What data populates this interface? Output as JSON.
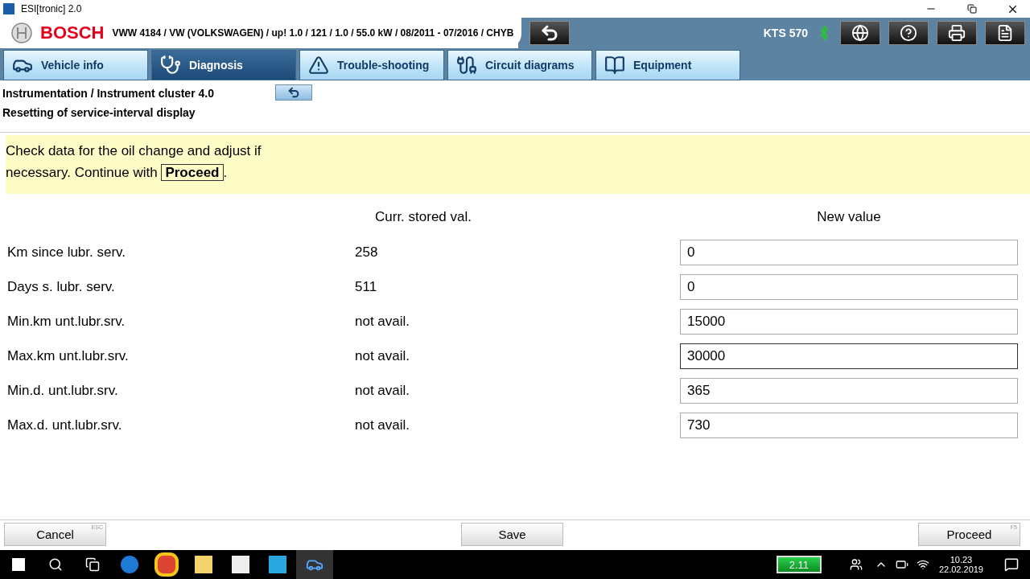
{
  "window": {
    "title": "ESI[tronic] 2.0"
  },
  "header": {
    "brand": "BOSCH",
    "vehicle": "VWW 4184 / VW (VOLKSWAGEN) / up! 1.0 / 121 / 1.0 / 55.0 kW / 08/2011 - 07/2016 / CHYB",
    "device": "KTS 570"
  },
  "tabs": [
    {
      "label": "Vehicle info",
      "selected": false
    },
    {
      "label": "Diagnosis",
      "selected": true
    },
    {
      "label": "Trouble-shooting",
      "selected": false
    },
    {
      "label": "Circuit diagrams",
      "selected": false
    },
    {
      "label": "Equipment",
      "selected": false
    }
  ],
  "breadcrumb": [
    "Instrumentation / Instrument cluster 4.0",
    "Resetting of service-interval display"
  ],
  "message": {
    "text_before": "Check data for the oil change and adjust if necessary. Continue with",
    "key": "Proceed",
    "text_after": "."
  },
  "columns": [
    "Curr. stored val.",
    "New value"
  ],
  "rows": [
    {
      "label": "Km since lubr. serv.",
      "current": "258",
      "value": "0",
      "focused": false
    },
    {
      "label": "Days s. lubr. serv.",
      "current": "511",
      "value": "0",
      "focused": false
    },
    {
      "label": "Min.km unt.lubr.srv.",
      "current": "not avail.",
      "value": "15000",
      "focused": false
    },
    {
      "label": "Max.km unt.lubr.srv.",
      "current": "not avail.",
      "value": "30000",
      "focused": true
    },
    {
      "label": "Min.d. unt.lubr.srv.",
      "current": "not avail.",
      "value": "365",
      "focused": false
    },
    {
      "label": "Max.d. unt.lubr.srv.",
      "current": "not avail.",
      "value": "730",
      "focused": false
    }
  ],
  "buttons": [
    {
      "label": "Cancel",
      "hotkey": "ESC"
    },
    {
      "label": "Save"
    },
    {
      "label": "Proceed",
      "hotkey": "F5"
    }
  ],
  "taskbar": {
    "battery": "2.11",
    "time": "10.23",
    "date": "22.02.2019"
  }
}
